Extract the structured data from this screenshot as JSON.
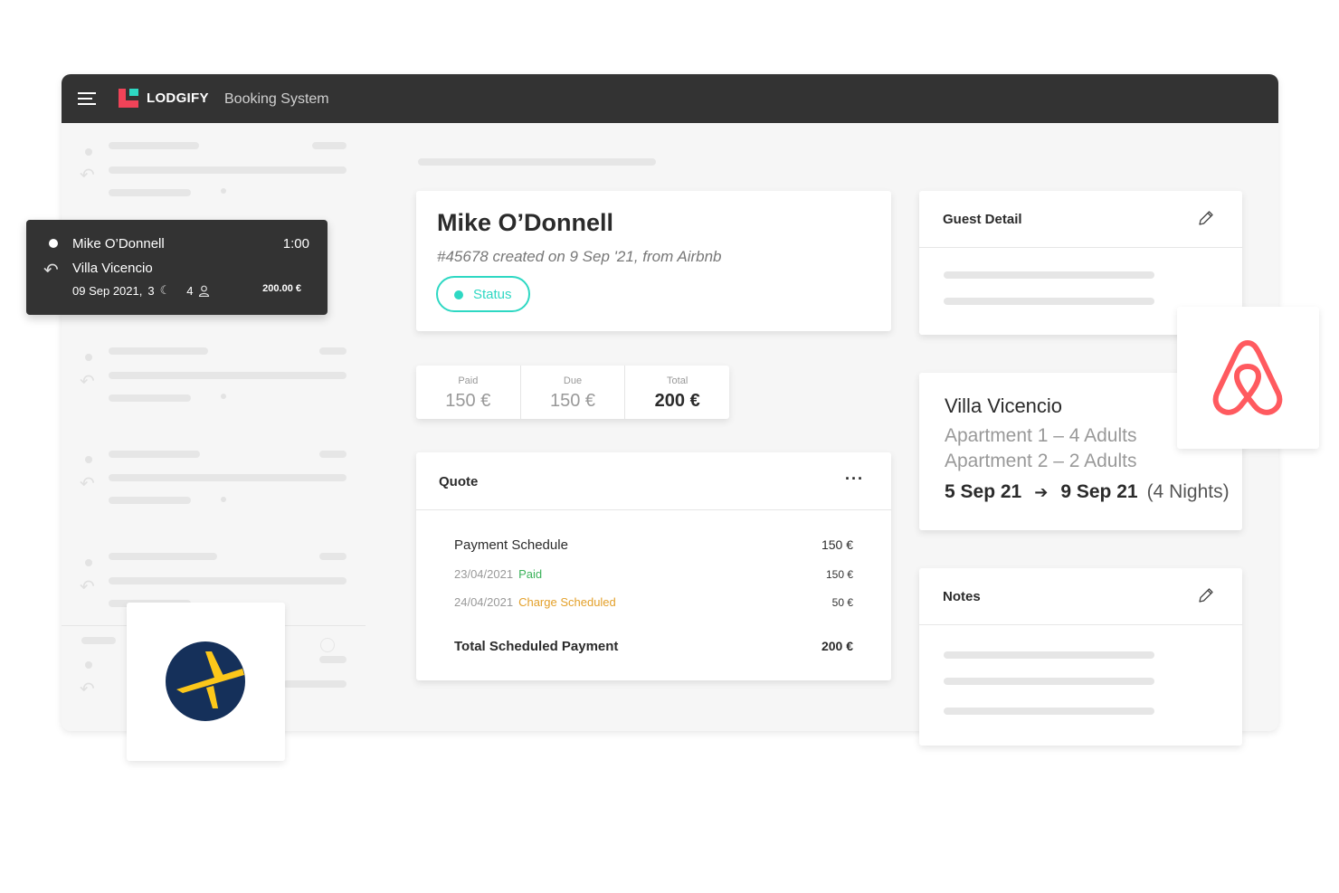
{
  "topbar": {
    "brand": "LODGIFY",
    "subtitle": "Booking System"
  },
  "booking_card": {
    "name": "Mike O’Donnell",
    "time": "1:00",
    "property": "Villa Vicencio",
    "date": "09 Sep 2021,",
    "nights": "3",
    "guests": "4",
    "amount": "200.00 €"
  },
  "guest": {
    "name": "Mike O’Donnell",
    "reference": "#45678 created on 9 Sep '21, from Airbnb",
    "status": "Status"
  },
  "amounts": [
    {
      "label": "Paid",
      "value": "150 €"
    },
    {
      "label": "Due",
      "value": "150 €"
    },
    {
      "label": "Total",
      "value": "200 €"
    }
  ],
  "quote": {
    "title": "Quote",
    "more": "···",
    "schedule_label": "Payment Schedule",
    "schedule_amount": "150 €",
    "rows": [
      {
        "date": "23/04/2021",
        "status": "Paid",
        "amount": "150 €"
      },
      {
        "date": "24/04/2021",
        "status": "Charge Scheduled",
        "amount": "50 €"
      }
    ],
    "total_label": "Total Scheduled Payment",
    "total_amount": "200 €"
  },
  "guest_detail": {
    "title": "Guest Detail"
  },
  "villa": {
    "name": "Villa Vicencio",
    "apt1": "Apartment 1 – 4 Adults",
    "apt2": "Apartment 2 – 2 Adults",
    "checkin": "5 Sep 21",
    "checkout": "9 Sep 21",
    "nights": "(4 Nights)"
  },
  "notes": {
    "title": "Notes"
  },
  "icons": {
    "menu": "hamburger-menu-icon",
    "reply": "reply-arrow-icon",
    "moon": "moon-icon",
    "person": "person-icon",
    "pencil": "pencil-icon",
    "more": "more-dots-icon",
    "airbnb": "airbnb-logo",
    "expedia": "expedia-logo"
  },
  "colors": {
    "topbar": "#333333",
    "brand_red": "#f04358",
    "brand_green": "#2ed8c3",
    "status": "#2ed8c3",
    "paid": "#3bb25a",
    "scheduled": "#e3a02a",
    "airbnb": "#ff5a5f",
    "expedia_navy": "#15305a",
    "expedia_yellow": "#fcc71a"
  }
}
